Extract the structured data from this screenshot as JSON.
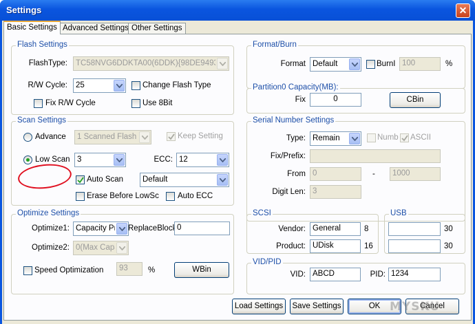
{
  "window": {
    "title": "Settings",
    "close_glyph": "✕"
  },
  "tabs": [
    "Basic Settings",
    "Advanced Settings",
    "Other Settings"
  ],
  "flash_settings": {
    "title": "Flash Settings",
    "flash_type_label": "FlashType:",
    "flash_type_value": "TC58NVG6DDKTA00(6DDK){98DE94937€",
    "rw_cycle_label": "R/W Cycle:",
    "rw_cycle_value": "25",
    "change_flash_type_label": "Change Flash Type",
    "fix_rw_cycle_label": "Fix R/W Cycle",
    "use_8bit_label": "Use 8Bit"
  },
  "scan_settings": {
    "title": "Scan Settings",
    "advance_label": "Advance",
    "advance_value": "1 Scanned Flash",
    "keep_setting_label": "Keep Setting",
    "low_scan_label": "Low Scan",
    "low_scan_value": "3",
    "ecc_label": "ECC:",
    "ecc_value": "12",
    "auto_scan_label": "Auto Scan",
    "auto_scan_value": "Default",
    "erase_label": "Erase Before LowSc",
    "auto_ecc_label": "Auto ECC"
  },
  "optimize_settings": {
    "title": "Optimize Settings",
    "optimize1_label": "Optimize1:",
    "optimize1_value": "Capacity Pri",
    "replace_block_label": "ReplaceBlock",
    "replace_block_value": "0",
    "optimize2_label": "Optimize2:",
    "optimize2_value": "0(Max Capa",
    "speed_label": "Speed Optimization",
    "speed_value": "93",
    "percent": "%",
    "wbin_label": "WBin"
  },
  "format_burn": {
    "title": "Format/Burn",
    "format_label": "Format",
    "format_value": "Default",
    "burnl_label": "BurnI",
    "burn_value": "100",
    "percent": "%"
  },
  "partition0": {
    "title": "Partition0 Capacity(MB):",
    "fix_label": "Fix",
    "fix_value": "0",
    "cbin_label": "CBin"
  },
  "serial_number": {
    "title": "Serial Number Settings",
    "type_label": "Type:",
    "type_value": "Remain",
    "numb_label": "Numb",
    "ascii_label": "ASCII",
    "fix_prefix_label": "Fix/Prefix:",
    "fix_prefix_value": "",
    "from_label": "From",
    "from_value": "0",
    "dash": "-",
    "to_value": "1000",
    "digit_len_label": "Digit Len:",
    "digit_len_value": "3"
  },
  "scsi": {
    "title": "SCSI",
    "vendor_label": "Vendor:",
    "vendor_value": "General",
    "vendor_len": "8",
    "product_label": "Product:",
    "product_value": "UDisk",
    "product_len": "16"
  },
  "usb": {
    "title": "USB",
    "vendor_value": "",
    "vendor_len": "30",
    "product_value": "",
    "product_len": "30"
  },
  "vid_pid": {
    "title": "VID/PID",
    "vid_label": "VID:",
    "vid_value": "ABCD",
    "pid_label": "PID:",
    "pid_value": "1234"
  },
  "buttons": {
    "load": "Load Settings",
    "save": "Save Settings",
    "ok": "OK",
    "cancel": "Cancel"
  },
  "watermark": "MYSKU",
  "colors": {
    "group_title": "#1d4fa8",
    "annotation_red": "#e01020",
    "title_bar": "#0a56e0"
  }
}
